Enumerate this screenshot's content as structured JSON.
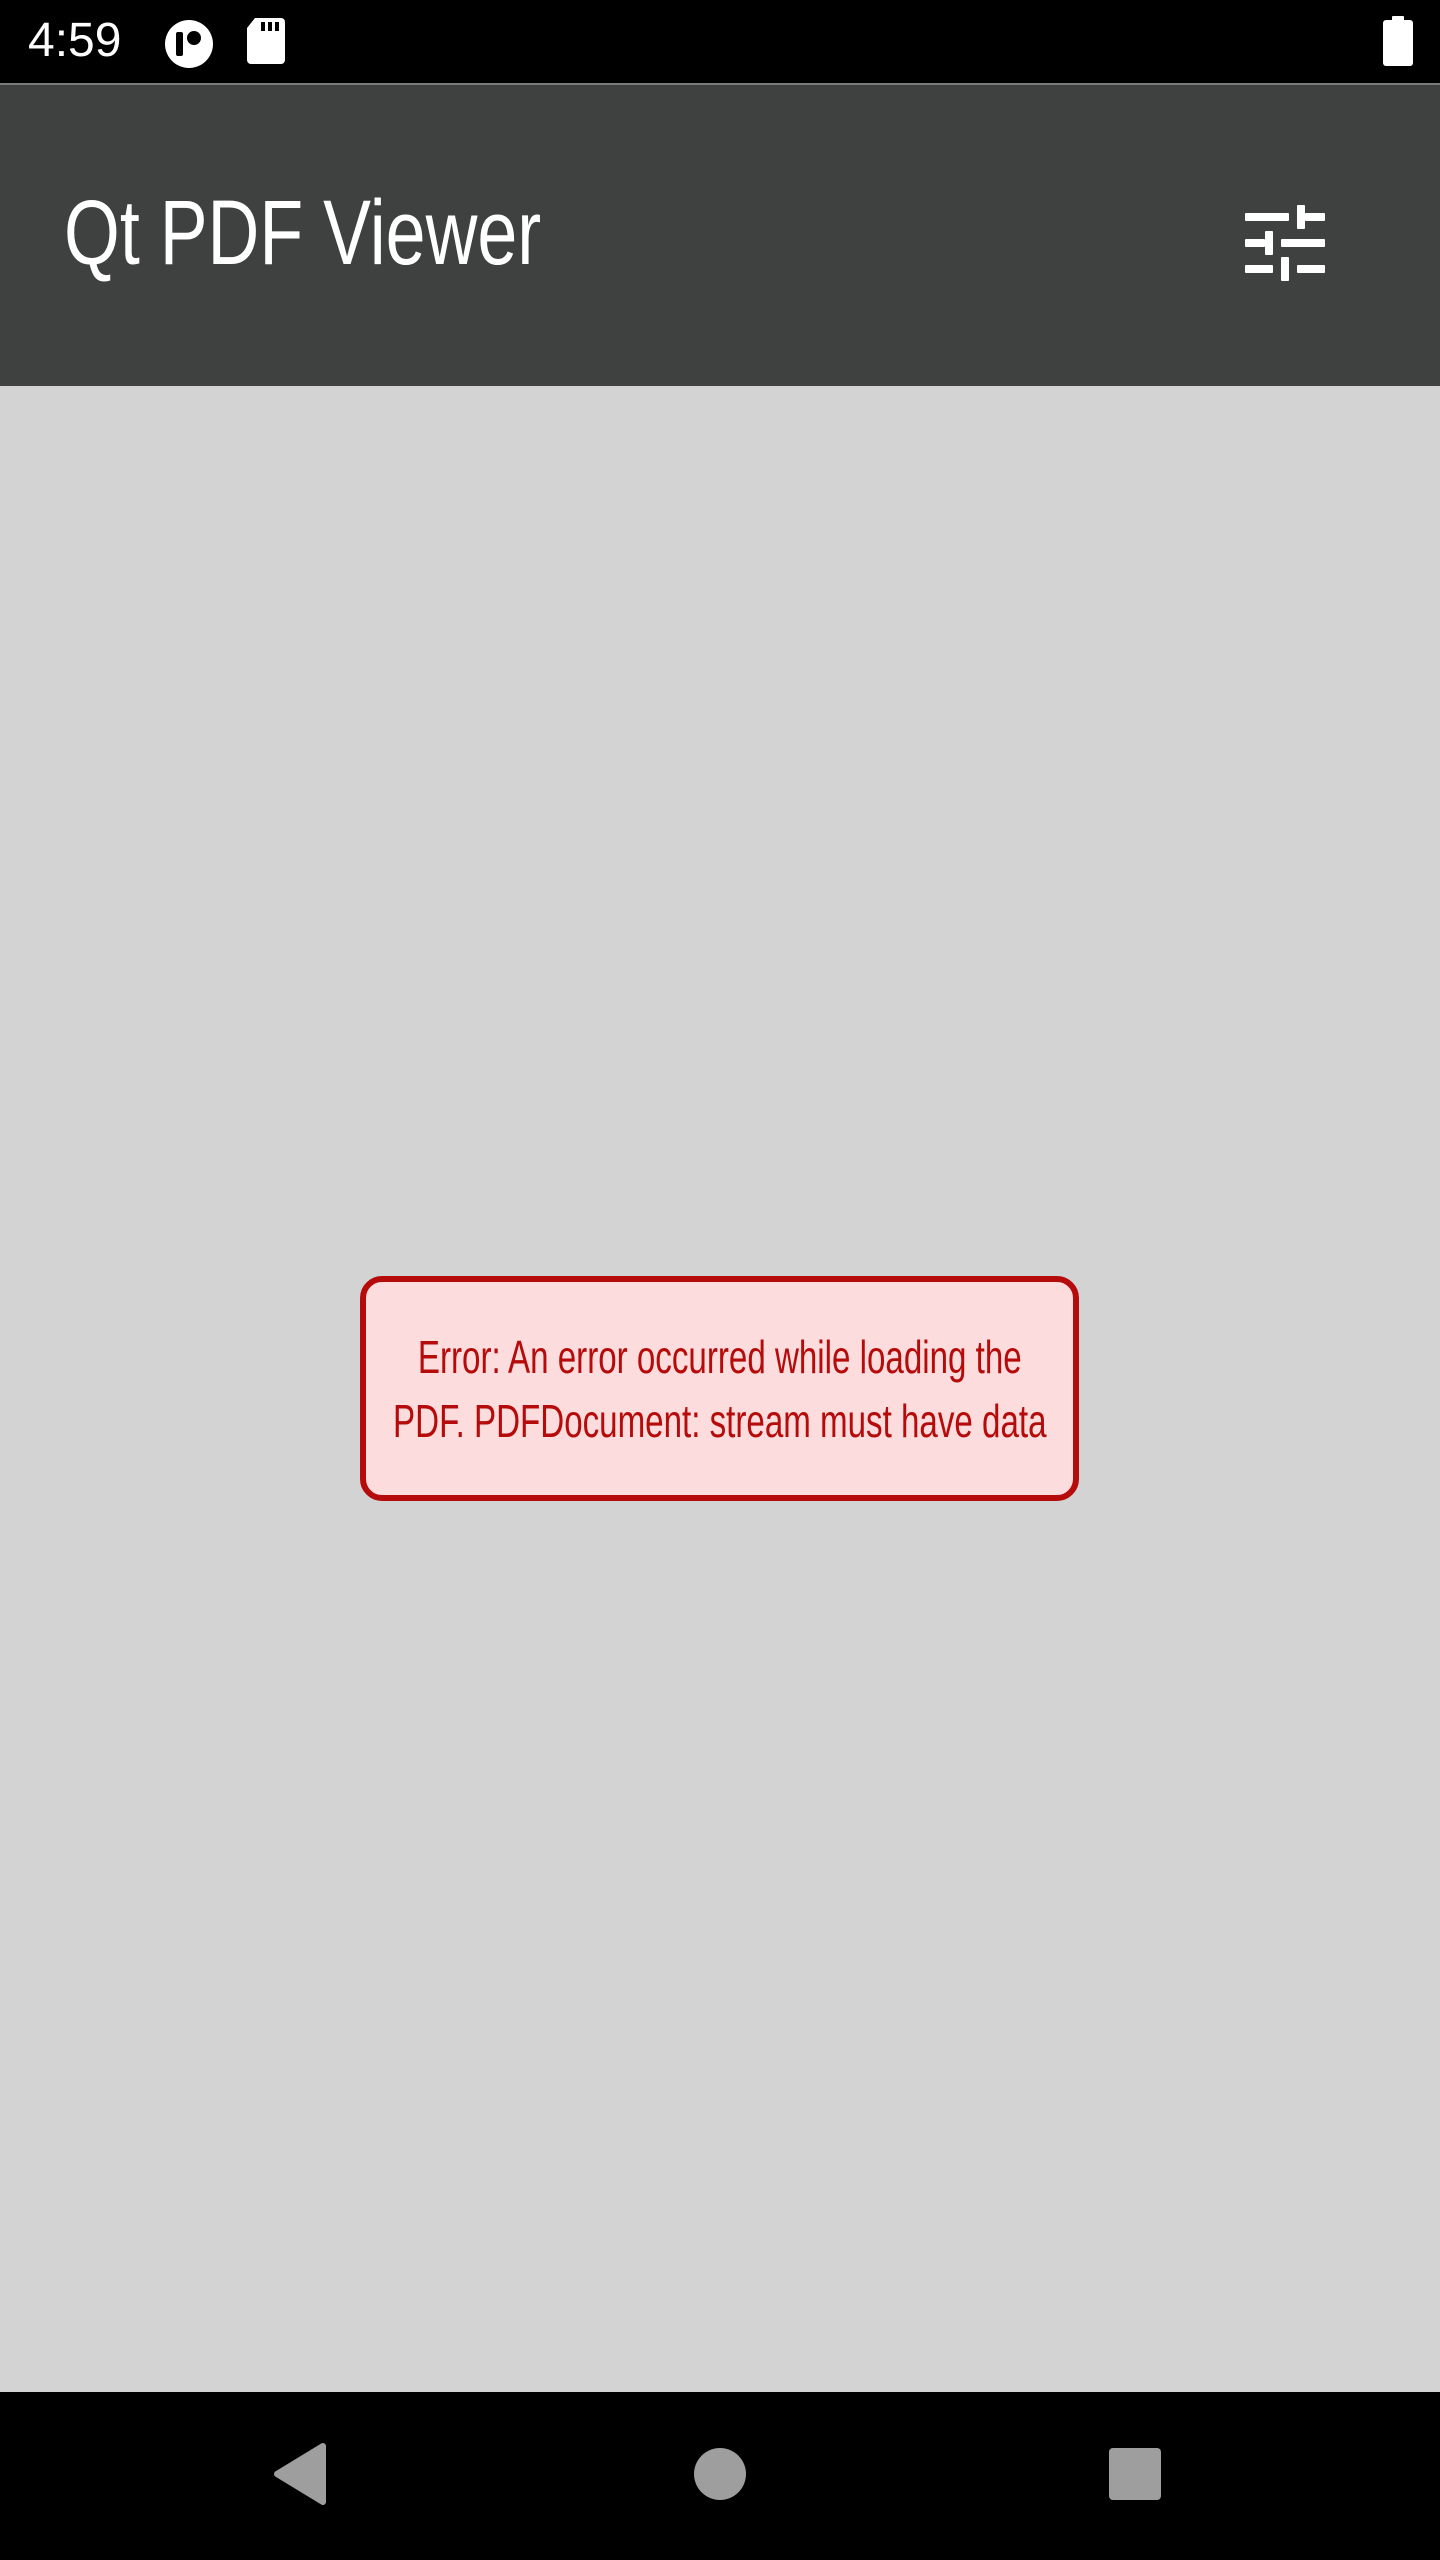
{
  "status_bar": {
    "time": "4:59",
    "icons": [
      "app-notification-icon",
      "sd-card-icon",
      "battery-icon"
    ]
  },
  "app_bar": {
    "title": "Qt PDF Viewer",
    "settings_icon": "tune-sliders-icon"
  },
  "error": {
    "line1": "Error: An error occurred while loading the",
    "line2": "PDF. PDFDocument: stream must have data"
  },
  "nav_bar": {
    "buttons": [
      "back-icon",
      "home-icon",
      "recents-icon"
    ]
  },
  "colors": {
    "app_bar": "#3f4140",
    "content_bg": "#d3d3d3",
    "error_border": "#b50b0b",
    "error_bg": "#fcdcdc"
  }
}
